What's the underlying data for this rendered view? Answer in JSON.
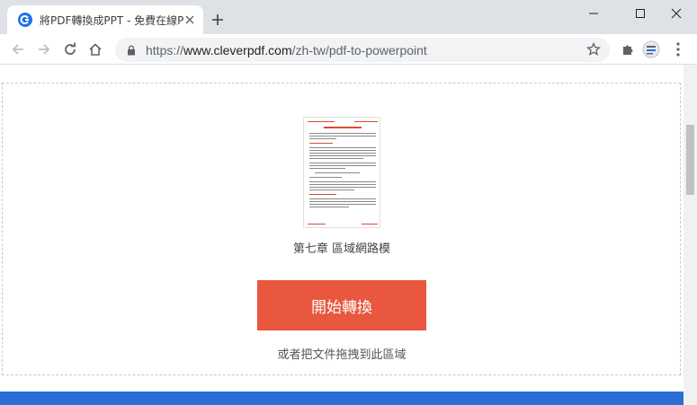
{
  "browser": {
    "tab": {
      "title": "將PDF轉換成PPT - 免費在線PDF",
      "favicon": "cleverpdf-icon"
    },
    "url": {
      "scheme": "https://",
      "host": "www.cleverpdf.com",
      "path": "/zh-tw/pdf-to-powerpoint"
    }
  },
  "page": {
    "file_name": "第七章 區域網路模",
    "start_button_label": "開始轉換",
    "drop_hint": "或者把文件拖拽到此區域"
  },
  "colors": {
    "accent": "#e8573e",
    "footer_blue": "#2b6fd6",
    "chrome_bg": "#dee1e6"
  }
}
